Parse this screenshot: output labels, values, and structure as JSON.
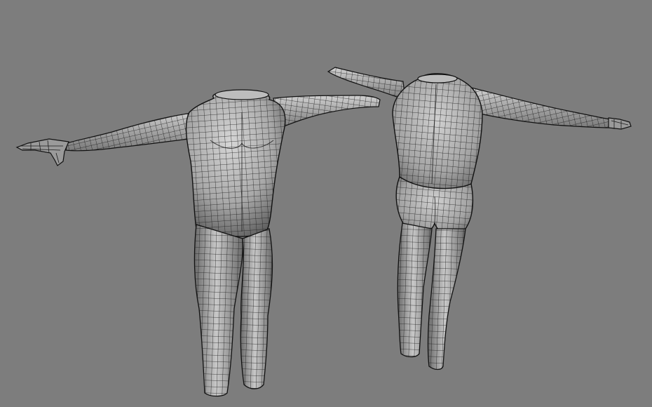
{
  "viewport": {
    "background": "#7d7d7d",
    "shading": "smooth-shaded-with-wireframe-edges"
  },
  "models": [
    {
      "id": "front",
      "view": "front",
      "surface_light": "#d2d2d2",
      "surface_dark": "#5e5e5e"
    },
    {
      "id": "back",
      "view": "back",
      "surface_light": "#cfcfcf",
      "surface_dark": "#5a5a5a"
    }
  ]
}
